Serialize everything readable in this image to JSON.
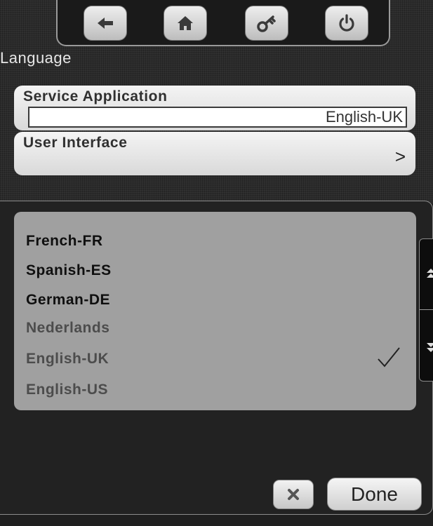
{
  "toolbar": {
    "buttons": [
      {
        "icon": "back-arrow-icon"
      },
      {
        "icon": "home-icon"
      },
      {
        "icon": "key-icon"
      },
      {
        "icon": "power-icon"
      }
    ]
  },
  "heading": "Language",
  "service_application": {
    "title": "Service Application",
    "value": "English-UK"
  },
  "user_interface": {
    "title": "User Interface",
    "chevron": ">"
  },
  "languages": [
    {
      "label": "French-FR",
      "style": "dark"
    },
    {
      "label": "Spanish-ES",
      "style": "dark"
    },
    {
      "label": "German-DE",
      "style": "dark"
    },
    {
      "label": "Nederlands",
      "style": "dim"
    },
    {
      "label": "English-UK",
      "style": "dim",
      "selected": true
    },
    {
      "label": "English-US",
      "style": "dim"
    }
  ],
  "actions": {
    "cancel_icon": "close-icon",
    "done_label": "Done"
  },
  "colors": {
    "list_background": "#a0a0a0",
    "card_background": "#e6e6e6",
    "app_background": "#1f1f1f"
  }
}
